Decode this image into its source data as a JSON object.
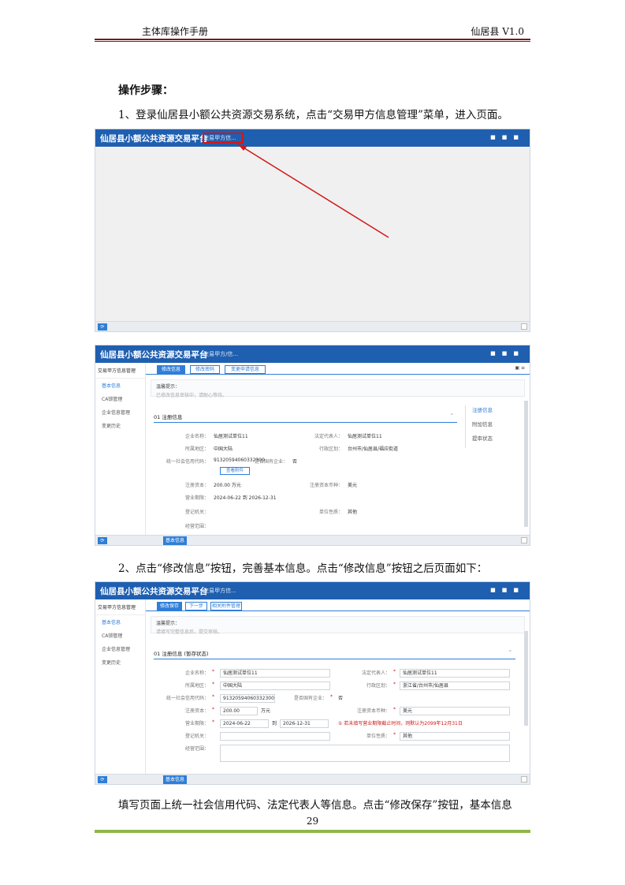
{
  "header": {
    "left": "主体库操作手册",
    "right": "仙居县   V1.0"
  },
  "doc": {
    "steps_title": "操作步骤：",
    "para1": "1、登录仙居县小额公共资源交易系统，点击“交易甲方信息管理”菜单，进入页面。",
    "para2": "2、点击“修改信息”按钮，完善基本信息。点击“修改信息”按钮之后页面如下：",
    "para3": "填写页面上统一社会信用代码、法定代表人等信息。点击“修改保存”按钮，基本信息",
    "page_number": "29"
  },
  "app": {
    "brand": "仙居县小额公共资源交易平台",
    "nav_tab1": "交易甲方信...",
    "nav_tab2": "交易甲方/信...",
    "nav_tab3": "交易甲方信...",
    "bottom_tab": "基本信息"
  },
  "shot2": {
    "sidebar_title": "交易甲方信息管理",
    "sidebar_items": [
      "基本信息",
      "CA锁管理",
      "企业信息管理",
      "变更历史"
    ],
    "buttons": [
      "修改信息",
      "修改密码",
      "变更申请信息"
    ],
    "tip_title": "温馨提示：",
    "tip_text": "已修改信息审核中，请耐心等待。",
    "section": "01   注册信息",
    "anchors": [
      "注册信息",
      "附加信息",
      "提审状态"
    ],
    "fields": [
      {
        "label": "企业名称：",
        "value": "仙居测试单位11"
      },
      {
        "label": "法定代表人：",
        "value": "仙居测试单位11"
      },
      {
        "label": "所属地区：",
        "value": "中国大陆"
      },
      {
        "label": "行政区划：",
        "value": "台州市/仙居县/福应街道"
      },
      {
        "label": "统一社会信用代码：",
        "value": "91320594060332300"
      },
      {
        "label": "是否国有企业：",
        "value": "否"
      },
      {
        "label": "注册资本：",
        "value": "200.00 万元"
      },
      {
        "label": "注册资本币种：",
        "value": "美元"
      },
      {
        "label": "营业期限：",
        "value": "2024-06-22    到    2026-12-31"
      },
      {
        "label": "登记机关：",
        "value": ""
      },
      {
        "label": "单位性质：",
        "value": "其他"
      },
      {
        "label": "经营范围：",
        "value": ""
      }
    ],
    "view_btn": "查看附件"
  },
  "shot3": {
    "sidebar_title": "交易甲方信息管理",
    "sidebar_items": [
      "基本信息",
      "CA锁管理",
      "企业信息管理",
      "变更历史"
    ],
    "buttons": [
      "修改保存",
      "下一步",
      "相关附件管理"
    ],
    "tip_title": "温馨提示：",
    "tip_text": "请填写完整信息后，提交审核。",
    "section": "01   注册信息   (暂存状态)",
    "fields": [
      {
        "label": "企业名称：",
        "value": "仙居测试单位11"
      },
      {
        "label": "法定代表人：",
        "value": "仙居测试单位11"
      },
      {
        "label": "所属地区：",
        "value": "中国大陆"
      },
      {
        "label": "行政区划：",
        "value": "浙江省/台州市/仙居县"
      },
      {
        "label": "统一社会信用代码：",
        "value": "91320594060332300"
      },
      {
        "label": "是否国有企业：",
        "value": "否"
      },
      {
        "label": "注册资本：",
        "value": "200.00"
      },
      {
        "label": "注册资本币种：",
        "value": "美元"
      },
      {
        "label": "营业期限：",
        "value": "2024-06-22"
      },
      {
        "label": "到",
        "value": "2026-12-31"
      },
      {
        "label": "登记机关：",
        "value": ""
      },
      {
        "label": "单位性质：",
        "value": "其他"
      },
      {
        "label": "经营范围：",
        "value": ""
      }
    ],
    "unit": "万元",
    "warning": "①  若未填写营业期限截止时间，则默认为2099年12月31日"
  },
  "colors": {
    "brand_blue": "#1f5fb0",
    "accent": "#2f7ed8",
    "annotation_red": "#d31616"
  }
}
